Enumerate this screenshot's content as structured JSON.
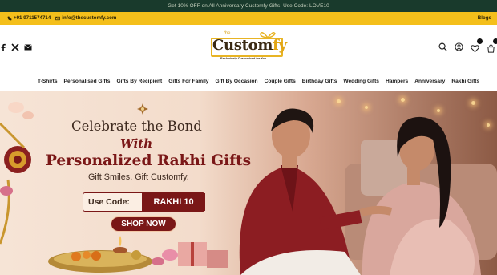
{
  "announcement": "Get 10% OFF on All Anniversary Customfy Gifts. Use Code: LOVE10",
  "contact": {
    "phone": "+91 9711574714",
    "email": "info@thecustomfy.com",
    "blogs_label": "Blogs"
  },
  "logo": {
    "the": "the",
    "word_main": "Custom",
    "word_accent": "fy",
    "tagline": "Exclusively Customized for You"
  },
  "social_icons": [
    "facebook-icon",
    "x-icon",
    "mail-icon"
  ],
  "header_icons": [
    "search-icon",
    "account-icon",
    "wishlist-icon",
    "cart-icon"
  ],
  "nav": [
    "T-Shirts",
    "Personalised Gifts",
    "Gifts By Recipient",
    "Gifts For Family",
    "Gift By Occasion",
    "Couple Gifts",
    "Birthday Gifts",
    "Wedding Gifts",
    "Hampers",
    "Anniversary",
    "Rakhi Gifts"
  ],
  "banner": {
    "headline": "Celebrate the Bond",
    "with": "With",
    "subheadline": "Personalized Rakhi Gifts",
    "tagline": "Gift Smiles. Gift Customfy.",
    "code_label": "Use Code:",
    "code": "RAKHI 10",
    "cta": "SHOP NOW"
  },
  "colors": {
    "top_bar": "#193a2c",
    "info_bar": "#f4bf1b",
    "brand_maroon": "#7a1717",
    "logo_gold": "#e8b424"
  }
}
